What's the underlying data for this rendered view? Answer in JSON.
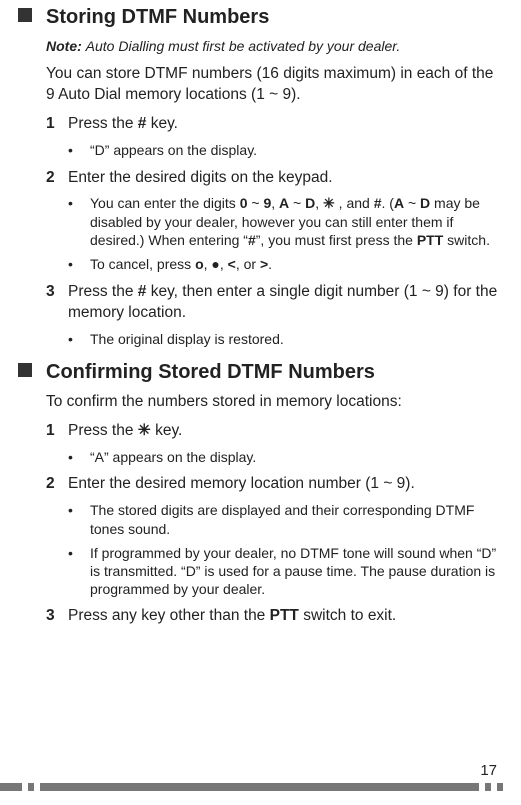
{
  "section1": {
    "title": "Storing DTMF Numbers",
    "note_label": "Note:",
    "note_text": "Auto Dialling must first be activated by your dealer.",
    "intro": "You can store DTMF numbers (16 digits maximum) in each of the 9 Auto Dial memory locations (1 ~ 9).",
    "step1": {
      "num": "1",
      "text_before": "Press the ",
      "key": "#",
      "text_after": " key.",
      "sub1": "“D” appears on the display."
    },
    "step2": {
      "num": "2",
      "text": "Enter the desired digits on the keypad.",
      "sub1_a": "You can enter the digits ",
      "sub1_b": "0",
      "sub1_c": " ~ ",
      "sub1_d": "9",
      "sub1_e": ", ",
      "sub1_f": "A",
      "sub1_g": " ~ ",
      "sub1_h": "D",
      "sub1_i": ", ",
      "sub1_star": "✳",
      "sub1_j": " , and ",
      "sub1_k": "#",
      "sub1_l": ".  (",
      "sub1_m": "A",
      "sub1_n": " ~ ",
      "sub1_o": "D",
      "sub1_p": " may be disabled by your dealer, however you can still enter them if desired.)  When entering “",
      "sub1_q": "#",
      "sub1_r": "”, you must first press the ",
      "sub1_s": "PTT",
      "sub1_t": " switch.",
      "sub2_a": "To cancel, press ",
      "sub2_b": "o",
      "sub2_c": ", ",
      "sub2_dot": "●",
      "sub2_d": ", ",
      "sub2_e": "<",
      "sub2_f": ", or ",
      "sub2_g": ">",
      "sub2_h": "."
    },
    "step3": {
      "num": "3",
      "text_a": "Press the ",
      "text_b": "#",
      "text_c": " key, then enter a single digit number (1 ~ 9) for the memory location.",
      "sub1": "The original display is restored."
    }
  },
  "section2": {
    "title": "Confirming Stored DTMF Numbers",
    "intro": "To confirm the numbers stored in memory locations:",
    "step1": {
      "num": "1",
      "text_a": "Press the ",
      "star": "✳",
      "text_b": " key.",
      "sub1": "“A” appears on the display."
    },
    "step2": {
      "num": "2",
      "text": "Enter the desired memory location number (1 ~ 9).",
      "sub1": "The stored digits are displayed and their corresponding DTMF tones sound.",
      "sub2": "If programmed by your dealer, no DTMF tone will sound when “D” is transmitted.  “D” is used for a pause time.  The pause duration is programmed by your dealer."
    },
    "step3": {
      "num": "3",
      "text_a": "Press any key other than the ",
      "text_b": "PTT",
      "text_c": " switch to exit."
    }
  },
  "page_number": "17",
  "bullet": "•"
}
